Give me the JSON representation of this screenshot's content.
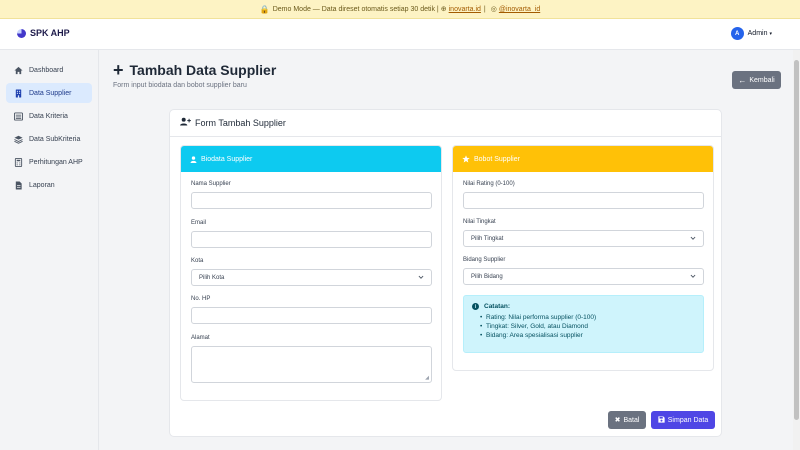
{
  "banner": {
    "text": "Demo Mode — Data direset otomatis setiap 30 detik |",
    "link1": "inovarta.id",
    "sep": "|",
    "link2": "@inovarta_id"
  },
  "navbar": {
    "brand": "SPK AHP",
    "user_initial": "A",
    "user_name": "Admin",
    "user_caret": "▾"
  },
  "sidebar": {
    "items": [
      {
        "label": "Dashboard",
        "icon": "home-icon"
      },
      {
        "label": "Data Supplier",
        "icon": "building-icon"
      },
      {
        "label": "Data Kriteria",
        "icon": "list-icon"
      },
      {
        "label": "Data SubKriteria",
        "icon": "layers-icon"
      },
      {
        "label": "Perhitungan AHP",
        "icon": "calculator-icon"
      },
      {
        "label": "Laporan",
        "icon": "file-icon"
      }
    ]
  },
  "header": {
    "plus": "+",
    "title": "Tambah Data Supplier",
    "subtitle": "Form input biodata dan bobot supplier baru",
    "back_label": "Kembali",
    "back_arrow": "←"
  },
  "card": {
    "title": "Form Tambah Supplier"
  },
  "biodata": {
    "title": "Biodata Supplier",
    "nama_label": "Nama Supplier",
    "nama_value": "",
    "email_label": "Email",
    "email_value": "",
    "kota_label": "Kota",
    "kota_value": "Pilih Kota",
    "hp_label": "No. HP",
    "hp_value": "",
    "alamat_label": "Alamat",
    "alamat_value": ""
  },
  "bobot": {
    "title": "Bobot Supplier",
    "rating_label": "Nilai Rating (0-100)",
    "rating_value": "",
    "tingkat_label": "Nilai Tingkat",
    "tingkat_value": "Pilih Tingkat",
    "bidang_label": "Bidang Supplier",
    "bidang_value": "Pilih Bidang"
  },
  "note": {
    "title": "Catatan:",
    "items": [
      "Rating: Nilai performa supplier (0-100)",
      "Tingkat: Silver, Gold, atau Diamond",
      "Bidang: Area spesialisasi supplier"
    ]
  },
  "actions": {
    "batal_label": "Batal",
    "batal_icon": "✖",
    "simpan_label": "Simpan Data"
  },
  "colors": {
    "primary": "#4f46e5",
    "cyan": "#0dcaf0",
    "yellow": "#ffc107",
    "info_bg": "#cff4fc",
    "secondary": "#6b7280",
    "active_nav": "#dbeafe"
  }
}
